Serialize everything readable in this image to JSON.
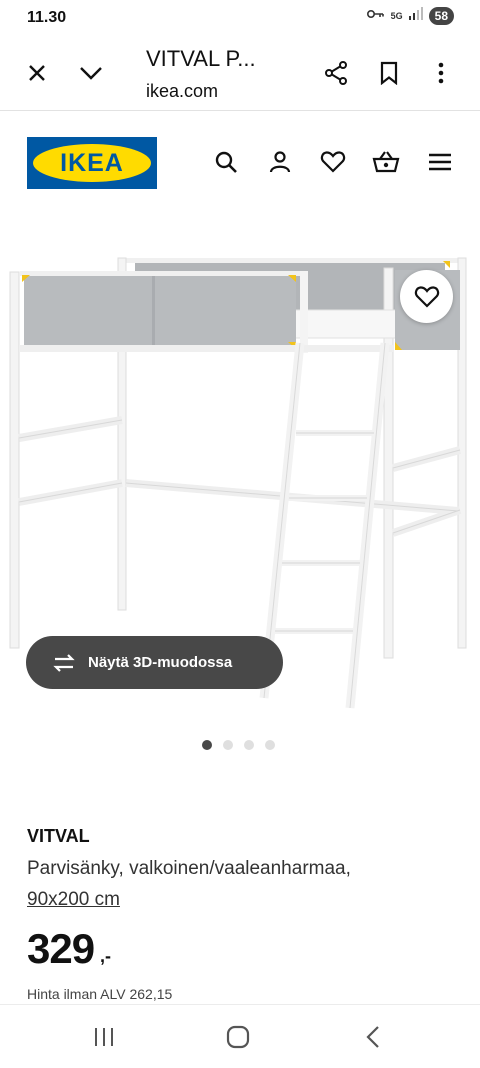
{
  "status_bar": {
    "time": "11.30",
    "battery": "58",
    "network": "5G",
    "icons": [
      "key-icon",
      "network-5g-icon",
      "signal-icon",
      "battery-icon"
    ]
  },
  "browser": {
    "tab_title": "VITVAL P...",
    "url": "ikea.com",
    "icons": [
      "close-icon",
      "chevron-down-icon",
      "share-icon",
      "bookmark-icon",
      "more-vert-icon"
    ]
  },
  "site": {
    "logo_text": "IKEA",
    "brand_colors": {
      "blue": "#0058a3",
      "yellow": "#ffdb00"
    },
    "nav_icons": [
      "search-icon",
      "user-icon",
      "heart-icon",
      "basket-icon",
      "menu-icon"
    ]
  },
  "gallery": {
    "view_3d_label": "Näytä 3D-muodossa",
    "slide_count": 4,
    "active_slide": 1
  },
  "product": {
    "name": "VITVAL",
    "description": "Parvisänky, valkoinen/vaaleanharmaa,",
    "size": "90x200 cm",
    "price": "329",
    "price_suffix": ",-",
    "price_ex_vat": "Hinta ilman ALV 262,15"
  },
  "system_nav": {
    "buttons": [
      "recent-apps-icon",
      "home-icon",
      "back-icon"
    ]
  }
}
